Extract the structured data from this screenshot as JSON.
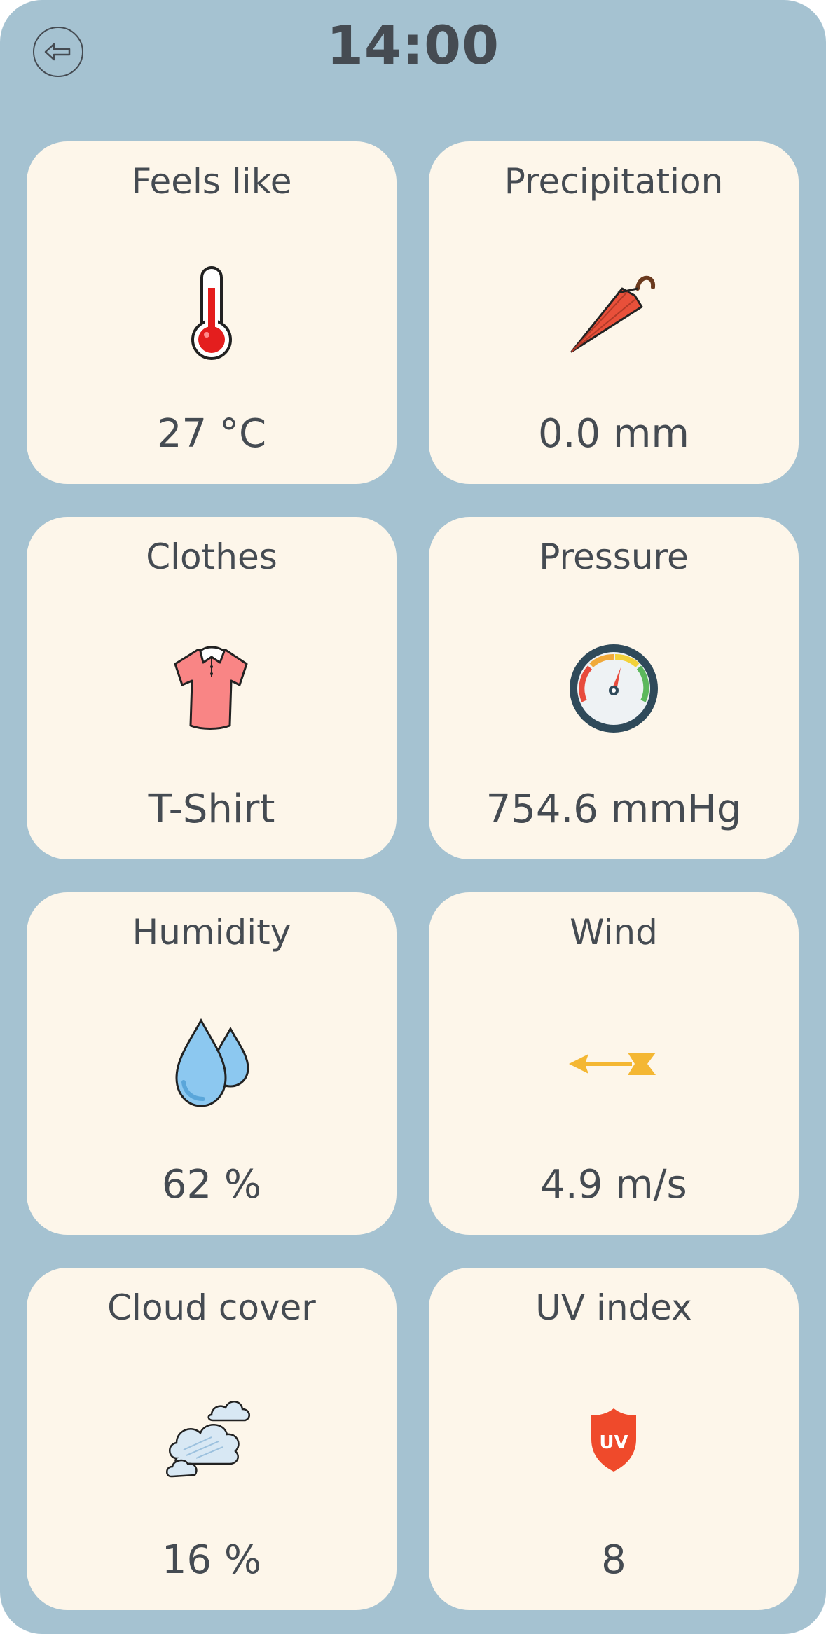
{
  "header": {
    "time": "14:00"
  },
  "cards": [
    {
      "label": "Feels like",
      "value": "27 °C",
      "icon": "thermometer-icon"
    },
    {
      "label": "Precipitation",
      "value": "0.0 mm",
      "icon": "umbrella-icon"
    },
    {
      "label": "Clothes",
      "value": "T-Shirt",
      "icon": "tshirt-icon"
    },
    {
      "label": "Pressure",
      "value": "754.6 mmHg",
      "icon": "barometer-icon"
    },
    {
      "label": "Humidity",
      "value": "62 %",
      "icon": "water-drops-icon"
    },
    {
      "label": "Wind",
      "value": "4.9 m/s",
      "icon": "wind-arrow-icon"
    },
    {
      "label": "Cloud cover",
      "value": "16 %",
      "icon": "clouds-icon"
    },
    {
      "label": "UV index",
      "value": "8",
      "icon": "uv-shield-icon",
      "icon_text": "UV"
    }
  ],
  "colors": {
    "background": "#a5c2d1",
    "card": "#fdf6ea",
    "text": "#454b52",
    "thermometer_red": "#e41e1e",
    "umbrella_red": "#e8503a",
    "tshirt_pink": "#f98585",
    "water_blue": "#8cc8f0",
    "wind_yellow": "#f4b733",
    "uv_red": "#ef4a2b"
  }
}
